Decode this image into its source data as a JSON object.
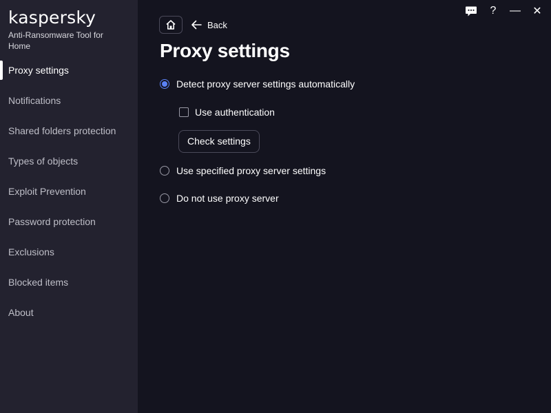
{
  "brand": {
    "logo": "kaspersky",
    "subtitle": "Anti-Ransomware Tool for Home"
  },
  "sidebar": {
    "items": [
      {
        "label": "Proxy settings",
        "active": true
      },
      {
        "label": "Notifications"
      },
      {
        "label": "Shared folders protection"
      },
      {
        "label": "Types of objects"
      },
      {
        "label": "Exploit Prevention"
      },
      {
        "label": "Password protection"
      },
      {
        "label": "Exclusions"
      },
      {
        "label": "Blocked items"
      },
      {
        "label": "About"
      }
    ]
  },
  "window_controls": {
    "help": "?",
    "minimize": "—",
    "close": "✕"
  },
  "nav": {
    "back_label": "Back"
  },
  "page": {
    "title": "Proxy settings",
    "options": {
      "auto": "Detect proxy server settings automatically",
      "use_auth": "Use authentication",
      "check_button": "Check settings",
      "specified": "Use specified proxy server settings",
      "none": "Do not use proxy server"
    },
    "selected": "auto",
    "use_auth_checked": false
  },
  "colors": {
    "background": "#14141f",
    "sidebar": "#23222f",
    "accent": "#5b82f5"
  },
  "icons": [
    "feedback-icon",
    "home-icon",
    "back-arrow-icon"
  ]
}
